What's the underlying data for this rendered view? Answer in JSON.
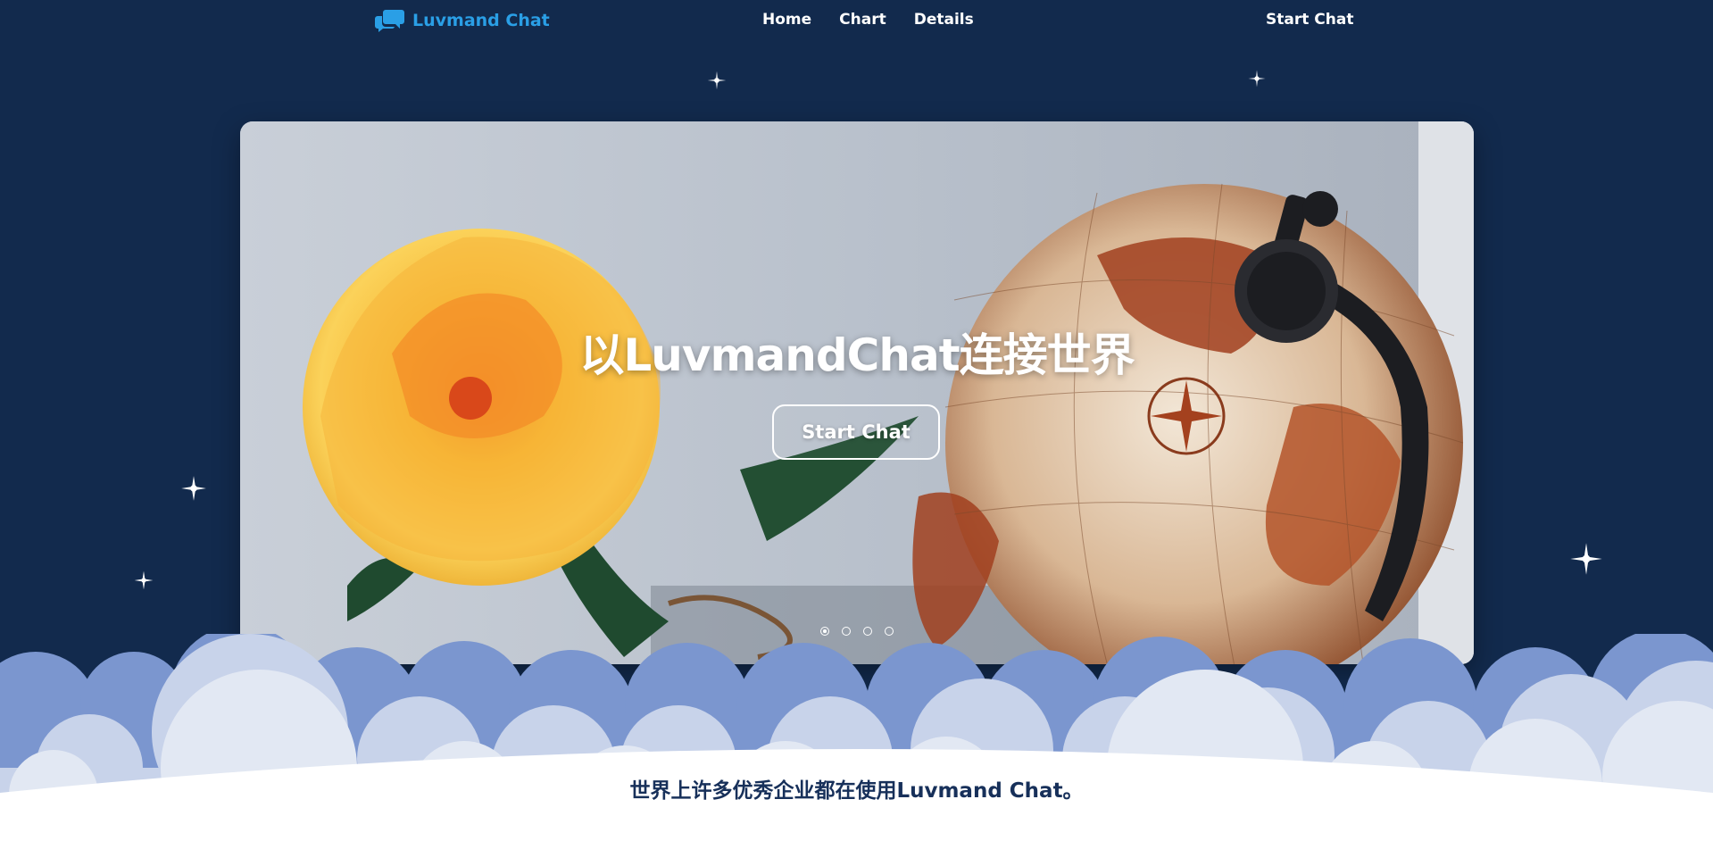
{
  "header": {
    "brand_name": "Luvmand Chat",
    "brand_icon": "chat-bubbles-icon",
    "nav": [
      "Home",
      "Chart",
      "Details"
    ],
    "cta": "Start Chat"
  },
  "hero": {
    "title": "以LuvmandChat连接世界",
    "button": "Start Chat",
    "slides_count": 4,
    "active_slide": 1
  },
  "tagline": "世界上许多优秀企业都在使用Luvmand Chat。",
  "colors": {
    "background": "#122a4d",
    "brand": "#2a9fe6",
    "text_light": "#ffffff",
    "tagline": "#17305a",
    "cloud_back": "#7b96cf",
    "cloud_front": "#dfe6f2"
  }
}
